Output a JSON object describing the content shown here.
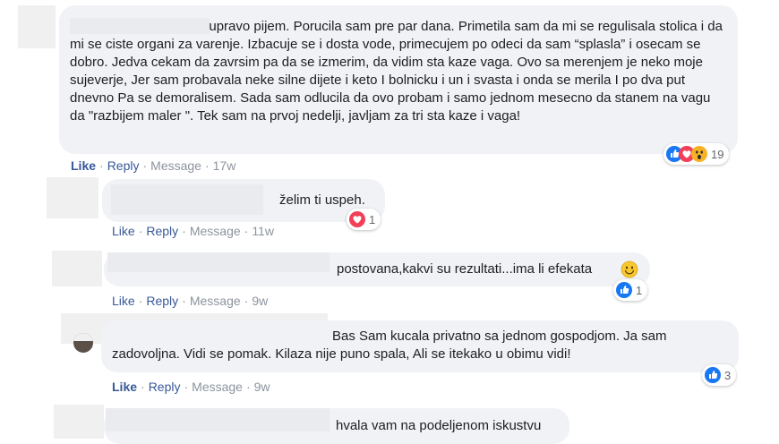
{
  "comments": [
    {
      "text": "Ja sad upravo pijem. Porucila sam pre par dana. Primetila sam da mi se regulisala stolica i da mi se ciste organi za varenje. Izbacuje se i dosta vode, primecujem po odeci da sam “splasla” i osecam se dobro. Jedva cekam da zavrsim pa da se izmerim, da vidim sta kaze vaga. Ovo sa merenjem je neko moje sujeverje, Jer sam probavala neke silne dijete i keto I bolnicku i un i svasta i onda se merila I po dva put dnevno Pa se demoralisem. Sada sam odlucila da ovo probam i samo jednom mesecno da stanem na vagu da \"razbijem maler \". Tek sam na prvoj nedelji, javljam za tri sta kaze i vaga!",
      "like": "Like",
      "reply": "Reply",
      "message": "Message",
      "time": "17w",
      "reactions": [
        "like",
        "love",
        "wow"
      ],
      "reaction_count": "19"
    },
    {
      "text": "želim ti uspeh.",
      "like": "Like",
      "reply": "Reply",
      "message": "Message",
      "time": "11w",
      "reactions": [
        "love"
      ],
      "reaction_count": "1"
    },
    {
      "text": "postovana,kakvi su rezultati...ima li efekata",
      "emoji": "smiley-emoji",
      "like": "Like",
      "reply": "Reply",
      "message": "Message",
      "time": "9w",
      "reactions": [
        "like"
      ],
      "reaction_count": "1"
    },
    {
      "text": "Bas Sam kucala privatno sa jednom gospodjom. Ja sam zadovoljna. Vidi se pomak. Kilaza nije puno spala, Ali se itekako u obimu vidi!",
      "like": "Like",
      "reply": "Reply",
      "message": "Message",
      "time": "9w",
      "reactions": [
        "like"
      ],
      "reaction_count": "3"
    },
    {
      "text": "hvala vam na podeljenom iskustvu"
    }
  ],
  "colors": {
    "like_blue": "#1877f2",
    "love_red": "#f33e58",
    "wow_yellow": "#f7b125",
    "link": "#385898",
    "bubble": "#f0f2f5"
  }
}
